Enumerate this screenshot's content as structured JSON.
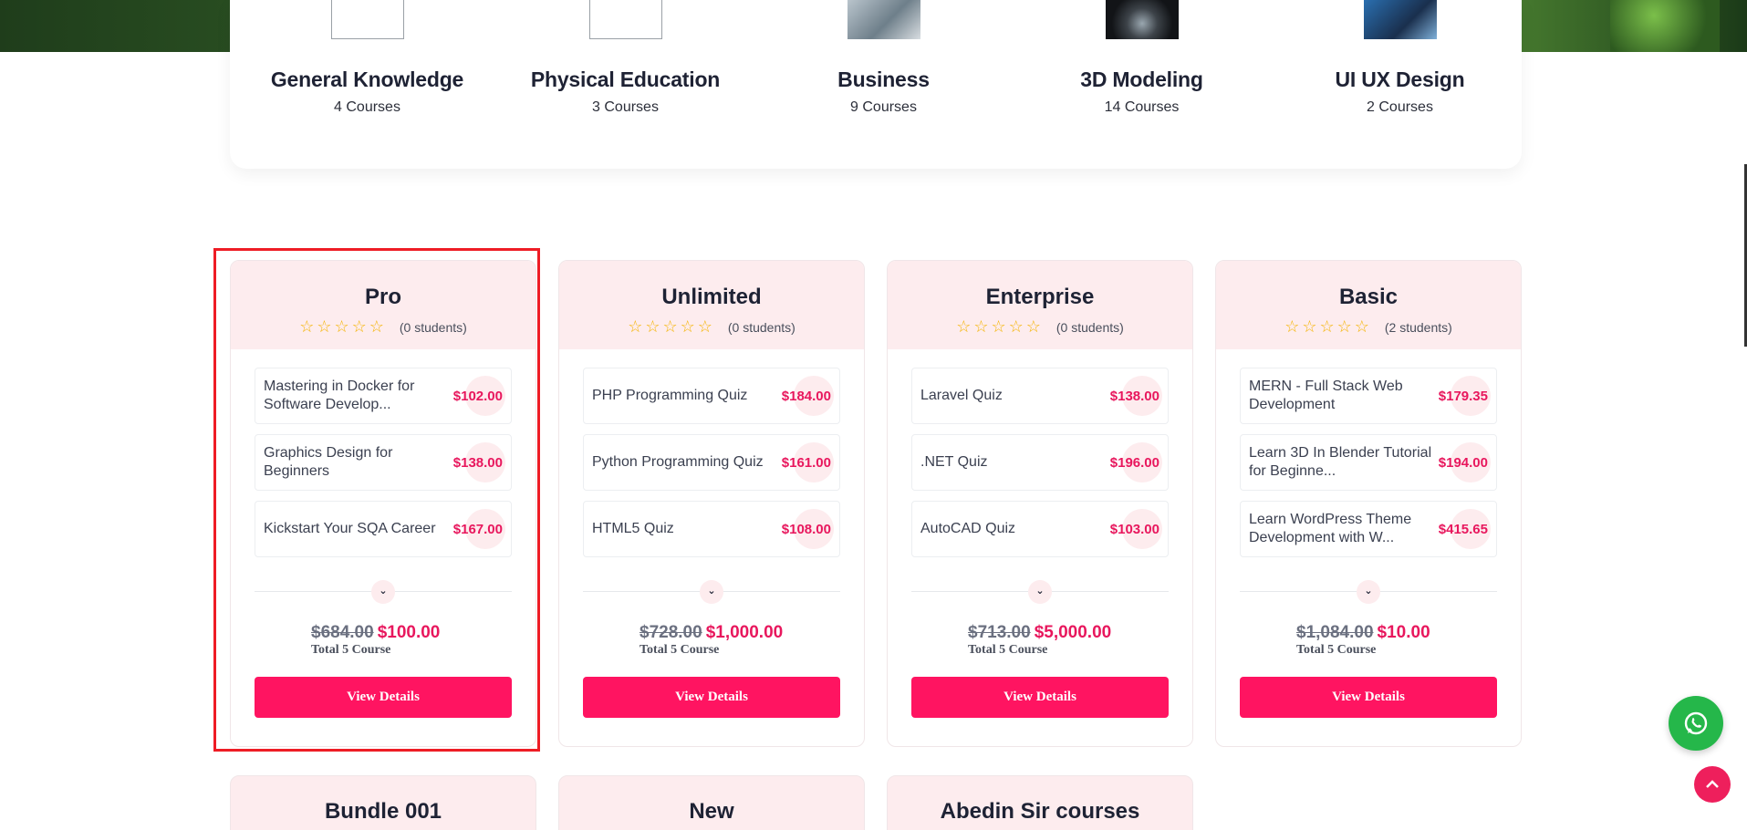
{
  "categories": [
    {
      "name": "General Knowledge",
      "count": "4 Courses",
      "thumb": "blank"
    },
    {
      "name": "Physical Education",
      "count": "3 Courses",
      "thumb": "blank"
    },
    {
      "name": "Business",
      "count": "9 Courses",
      "thumb": "photo"
    },
    {
      "name": "3D Modeling",
      "count": "14 Courses",
      "thumb": "photo"
    },
    {
      "name": "UI UX Design",
      "count": "2 Courses",
      "thumb": "photo"
    }
  ],
  "bundles": [
    {
      "title": "Pro",
      "students": "(0 students)",
      "courses": [
        {
          "name": "Mastering in Docker for Software Develop...",
          "price": "$102.00"
        },
        {
          "name": "Graphics Design for Beginners",
          "price": "$138.00"
        },
        {
          "name": "Kickstart Your SQA Career",
          "price": "$167.00"
        }
      ],
      "old_price": "$684.00",
      "new_price": "$100.00",
      "total": "Total 5 Course",
      "button": "View Details"
    },
    {
      "title": "Unlimited",
      "students": "(0 students)",
      "courses": [
        {
          "name": "PHP Programming Quiz",
          "price": "$184.00"
        },
        {
          "name": "Python Programming Quiz",
          "price": "$161.00"
        },
        {
          "name": "HTML5 Quiz",
          "price": "$108.00"
        }
      ],
      "old_price": "$728.00",
      "new_price": "$1,000.00",
      "total": "Total 5 Course",
      "button": "View Details"
    },
    {
      "title": "Enterprise",
      "students": "(0 students)",
      "courses": [
        {
          "name": "Laravel Quiz",
          "price": "$138.00"
        },
        {
          "name": ".NET Quiz",
          "price": "$196.00"
        },
        {
          "name": "AutoCAD Quiz",
          "price": "$103.00"
        }
      ],
      "old_price": "$713.00",
      "new_price": "$5,000.00",
      "total": "Total 5 Course",
      "button": "View Details"
    },
    {
      "title": "Basic",
      "students": "(2 students)",
      "courses": [
        {
          "name": "MERN - Full Stack Web Development",
          "price": "$179.35"
        },
        {
          "name": "Learn 3D In Blender Tutorial for Beginne...",
          "price": "$194.00"
        },
        {
          "name": "Learn WordPress Theme Development with W...",
          "price": "$415.65"
        }
      ],
      "old_price": "$1,084.00",
      "new_price": "$10.00",
      "total": "Total 5 Course",
      "button": "View Details"
    }
  ],
  "more_bundles": [
    {
      "title": "Bundle 001"
    },
    {
      "title": "New"
    },
    {
      "title": "Abedin Sir courses"
    }
  ],
  "icons": {
    "star": "☆",
    "chevron": "⌄",
    "whatsapp": "whatsapp-icon",
    "scroll_top": "chevron-up-icon"
  },
  "colors": {
    "accent": "#ff1461",
    "price": "#e8175d",
    "header_bg": "#fdecee",
    "whatsapp": "#25b74a",
    "highlight": "#ee1c25"
  }
}
